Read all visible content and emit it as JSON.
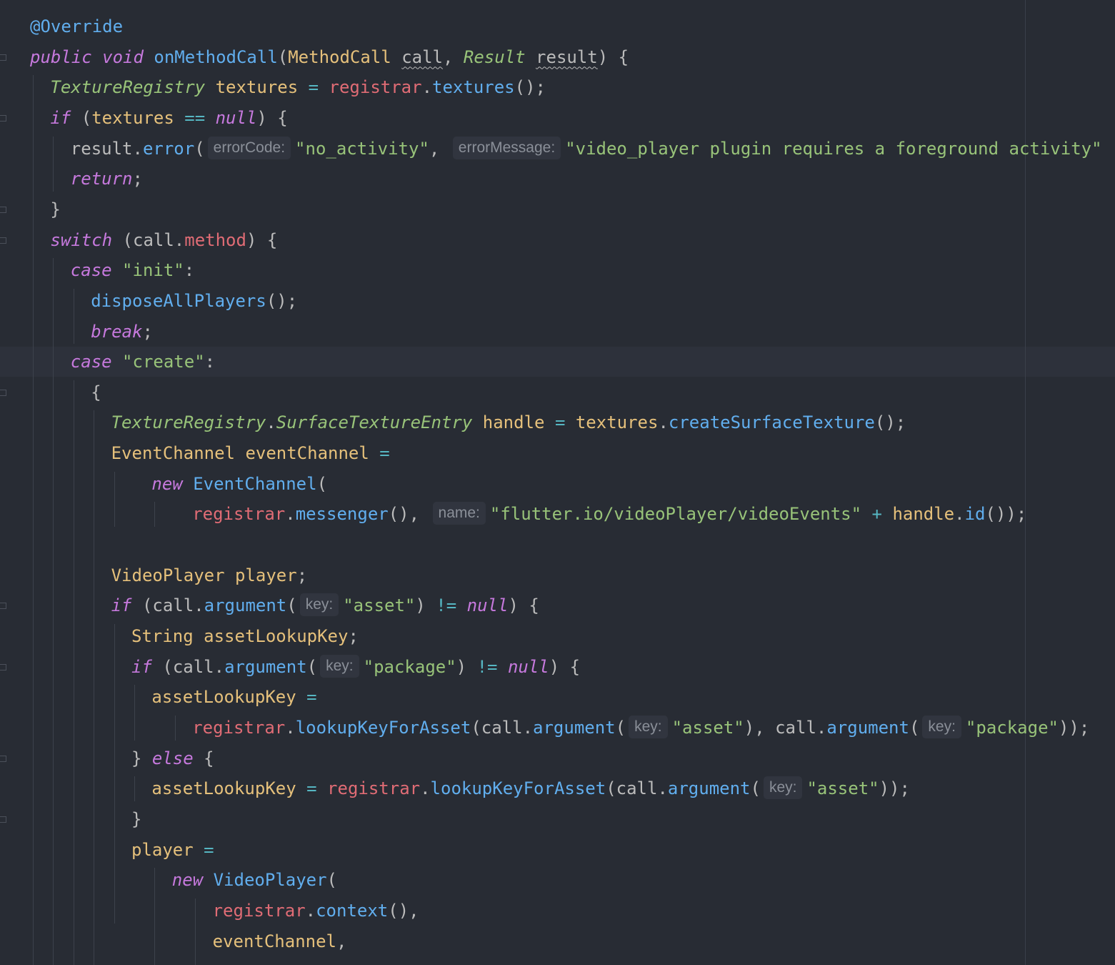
{
  "editor": {
    "language": "Java",
    "lines": [
      {
        "tokens": [
          {
            "t": "@Override",
            "c": "ann"
          }
        ]
      },
      {
        "tokens": [
          {
            "t": "public void ",
            "c": "kw"
          },
          {
            "t": "onMethodCall",
            "c": "fn"
          },
          {
            "t": "(",
            "c": "punc"
          },
          {
            "t": "MethodCall ",
            "c": "type"
          },
          {
            "t": "call",
            "c": "plain",
            "u": true
          },
          {
            "t": ", ",
            "c": "punc"
          },
          {
            "t": "Result ",
            "c": "typei"
          },
          {
            "t": "result",
            "c": "plain",
            "u": true
          },
          {
            "t": ") {",
            "c": "punc"
          }
        ]
      },
      {
        "tokens": [
          {
            "t": "TextureRegistry ",
            "c": "typei"
          },
          {
            "t": "textures ",
            "c": "var"
          },
          {
            "t": "= ",
            "c": "op"
          },
          {
            "t": "registrar",
            "c": "field"
          },
          {
            "t": ".",
            "c": "punc"
          },
          {
            "t": "textures",
            "c": "fn"
          },
          {
            "t": "();",
            "c": "punc"
          }
        ]
      },
      {
        "tokens": [
          {
            "t": "if ",
            "c": "kw"
          },
          {
            "t": "(",
            "c": "punc"
          },
          {
            "t": "textures ",
            "c": "var"
          },
          {
            "t": "== ",
            "c": "op"
          },
          {
            "t": "null",
            "c": "kw"
          },
          {
            "t": ") {",
            "c": "punc"
          }
        ]
      },
      {
        "tokens": [
          {
            "t": "result",
            "c": "plain"
          },
          {
            "t": ".",
            "c": "punc"
          },
          {
            "t": "error",
            "c": "fn"
          },
          {
            "t": "(",
            "c": "punc"
          },
          {
            "h": "errorCode:"
          },
          {
            "t": "\"no_activity\"",
            "c": "str"
          },
          {
            "t": ", ",
            "c": "punc"
          },
          {
            "h": "errorMessage:"
          },
          {
            "t": "\"video_player plugin requires a foreground activity\"",
            "c": "str"
          }
        ]
      },
      {
        "tokens": [
          {
            "t": "return",
            "c": "kw"
          },
          {
            "t": ";",
            "c": "punc"
          }
        ]
      },
      {
        "tokens": [
          {
            "t": "}",
            "c": "punc"
          }
        ]
      },
      {
        "tokens": [
          {
            "t": "switch ",
            "c": "kw"
          },
          {
            "t": "(",
            "c": "punc"
          },
          {
            "t": "call",
            "c": "plain"
          },
          {
            "t": ".",
            "c": "punc"
          },
          {
            "t": "method",
            "c": "field"
          },
          {
            "t": ") {",
            "c": "punc"
          }
        ]
      },
      {
        "tokens": [
          {
            "t": "case ",
            "c": "kw"
          },
          {
            "t": "\"init\"",
            "c": "str"
          },
          {
            "t": ":",
            "c": "punc"
          }
        ]
      },
      {
        "tokens": [
          {
            "t": "disposeAllPlayers",
            "c": "fn"
          },
          {
            "t": "();",
            "c": "punc"
          }
        ]
      },
      {
        "tokens": [
          {
            "t": "break",
            "c": "kw"
          },
          {
            "t": ";",
            "c": "punc"
          }
        ]
      },
      {
        "tokens": [
          {
            "t": "case ",
            "c": "kw"
          },
          {
            "t": "\"create\"",
            "c": "str"
          },
          {
            "t": ":",
            "c": "punc"
          }
        ]
      },
      {
        "tokens": [
          {
            "t": "{",
            "c": "punc"
          }
        ]
      },
      {
        "tokens": [
          {
            "t": "TextureRegistry",
            "c": "typei"
          },
          {
            "t": ".",
            "c": "punc"
          },
          {
            "t": "SurfaceTextureEntry ",
            "c": "typei"
          },
          {
            "t": "handle ",
            "c": "var"
          },
          {
            "t": "= ",
            "c": "op"
          },
          {
            "t": "textures",
            "c": "var"
          },
          {
            "t": ".",
            "c": "punc"
          },
          {
            "t": "createSurfaceTexture",
            "c": "fn"
          },
          {
            "t": "();",
            "c": "punc"
          }
        ]
      },
      {
        "tokens": [
          {
            "t": "EventChannel ",
            "c": "type"
          },
          {
            "t": "eventChannel ",
            "c": "var"
          },
          {
            "t": "=",
            "c": "op"
          }
        ]
      },
      {
        "tokens": [
          {
            "t": "new ",
            "c": "kw"
          },
          {
            "t": "EventChannel",
            "c": "fn"
          },
          {
            "t": "(",
            "c": "punc"
          }
        ]
      },
      {
        "tokens": [
          {
            "t": "registrar",
            "c": "field"
          },
          {
            "t": ".",
            "c": "punc"
          },
          {
            "t": "messenger",
            "c": "fn"
          },
          {
            "t": "(), ",
            "c": "punc"
          },
          {
            "h": "name:"
          },
          {
            "t": "\"flutter.io/videoPlayer/videoEvents\" ",
            "c": "str"
          },
          {
            "t": "+ ",
            "c": "op"
          },
          {
            "t": "handle",
            "c": "var"
          },
          {
            "t": ".",
            "c": "punc"
          },
          {
            "t": "id",
            "c": "fn"
          },
          {
            "t": "());",
            "c": "punc"
          }
        ]
      },
      {
        "tokens": []
      },
      {
        "tokens": [
          {
            "t": "VideoPlayer ",
            "c": "type"
          },
          {
            "t": "player",
            "c": "var"
          },
          {
            "t": ";",
            "c": "punc"
          }
        ]
      },
      {
        "tokens": [
          {
            "t": "if ",
            "c": "kw"
          },
          {
            "t": "(",
            "c": "punc"
          },
          {
            "t": "call",
            "c": "plain"
          },
          {
            "t": ".",
            "c": "punc"
          },
          {
            "t": "argument",
            "c": "fn"
          },
          {
            "t": "(",
            "c": "punc"
          },
          {
            "h": "key:"
          },
          {
            "t": "\"asset\"",
            "c": "str"
          },
          {
            "t": ") ",
            "c": "punc"
          },
          {
            "t": "!= ",
            "c": "op"
          },
          {
            "t": "null",
            "c": "kw"
          },
          {
            "t": ") {",
            "c": "punc"
          }
        ]
      },
      {
        "tokens": [
          {
            "t": "String ",
            "c": "type"
          },
          {
            "t": "assetLookupKey",
            "c": "var"
          },
          {
            "t": ";",
            "c": "punc"
          }
        ]
      },
      {
        "tokens": [
          {
            "t": "if ",
            "c": "kw"
          },
          {
            "t": "(",
            "c": "punc"
          },
          {
            "t": "call",
            "c": "plain"
          },
          {
            "t": ".",
            "c": "punc"
          },
          {
            "t": "argument",
            "c": "fn"
          },
          {
            "t": "(",
            "c": "punc"
          },
          {
            "h": "key:"
          },
          {
            "t": "\"package\"",
            "c": "str"
          },
          {
            "t": ") ",
            "c": "punc"
          },
          {
            "t": "!= ",
            "c": "op"
          },
          {
            "t": "null",
            "c": "kw"
          },
          {
            "t": ") {",
            "c": "punc"
          }
        ]
      },
      {
        "tokens": [
          {
            "t": "assetLookupKey ",
            "c": "var"
          },
          {
            "t": "=",
            "c": "op"
          }
        ]
      },
      {
        "tokens": [
          {
            "t": "registrar",
            "c": "field"
          },
          {
            "t": ".",
            "c": "punc"
          },
          {
            "t": "lookupKeyForAsset",
            "c": "fn"
          },
          {
            "t": "(",
            "c": "punc"
          },
          {
            "t": "call",
            "c": "plain"
          },
          {
            "t": ".",
            "c": "punc"
          },
          {
            "t": "argument",
            "c": "fn"
          },
          {
            "t": "(",
            "c": "punc"
          },
          {
            "h": "key:"
          },
          {
            "t": "\"asset\"",
            "c": "str"
          },
          {
            "t": "), ",
            "c": "punc"
          },
          {
            "t": "call",
            "c": "plain"
          },
          {
            "t": ".",
            "c": "punc"
          },
          {
            "t": "argument",
            "c": "fn"
          },
          {
            "t": "(",
            "c": "punc"
          },
          {
            "h": "key:"
          },
          {
            "t": "\"package\"",
            "c": "str"
          },
          {
            "t": "));",
            "c": "punc"
          }
        ]
      },
      {
        "tokens": [
          {
            "t": "} ",
            "c": "punc"
          },
          {
            "t": "else ",
            "c": "kw"
          },
          {
            "t": "{",
            "c": "punc"
          }
        ]
      },
      {
        "tokens": [
          {
            "t": "assetLookupKey ",
            "c": "var"
          },
          {
            "t": "= ",
            "c": "op"
          },
          {
            "t": "registrar",
            "c": "field"
          },
          {
            "t": ".",
            "c": "punc"
          },
          {
            "t": "lookupKeyForAsset",
            "c": "fn"
          },
          {
            "t": "(",
            "c": "punc"
          },
          {
            "t": "call",
            "c": "plain"
          },
          {
            "t": ".",
            "c": "punc"
          },
          {
            "t": "argument",
            "c": "fn"
          },
          {
            "t": "(",
            "c": "punc"
          },
          {
            "h": "key:"
          },
          {
            "t": "\"asset\"",
            "c": "str"
          },
          {
            "t": "));",
            "c": "punc"
          }
        ]
      },
      {
        "tokens": [
          {
            "t": "}",
            "c": "punc"
          }
        ]
      },
      {
        "tokens": [
          {
            "t": "player ",
            "c": "var"
          },
          {
            "t": "=",
            "c": "op"
          }
        ]
      },
      {
        "tokens": [
          {
            "t": "new ",
            "c": "kw"
          },
          {
            "t": "VideoPlayer",
            "c": "fn"
          },
          {
            "t": "(",
            "c": "punc"
          }
        ]
      },
      {
        "tokens": [
          {
            "t": "registrar",
            "c": "field"
          },
          {
            "t": ".",
            "c": "punc"
          },
          {
            "t": "context",
            "c": "fn"
          },
          {
            "t": "(),",
            "c": "punc"
          }
        ]
      },
      {
        "tokens": [
          {
            "t": "eventChannel",
            "c": "var"
          },
          {
            "t": ",",
            "c": "punc"
          }
        ]
      }
    ]
  }
}
